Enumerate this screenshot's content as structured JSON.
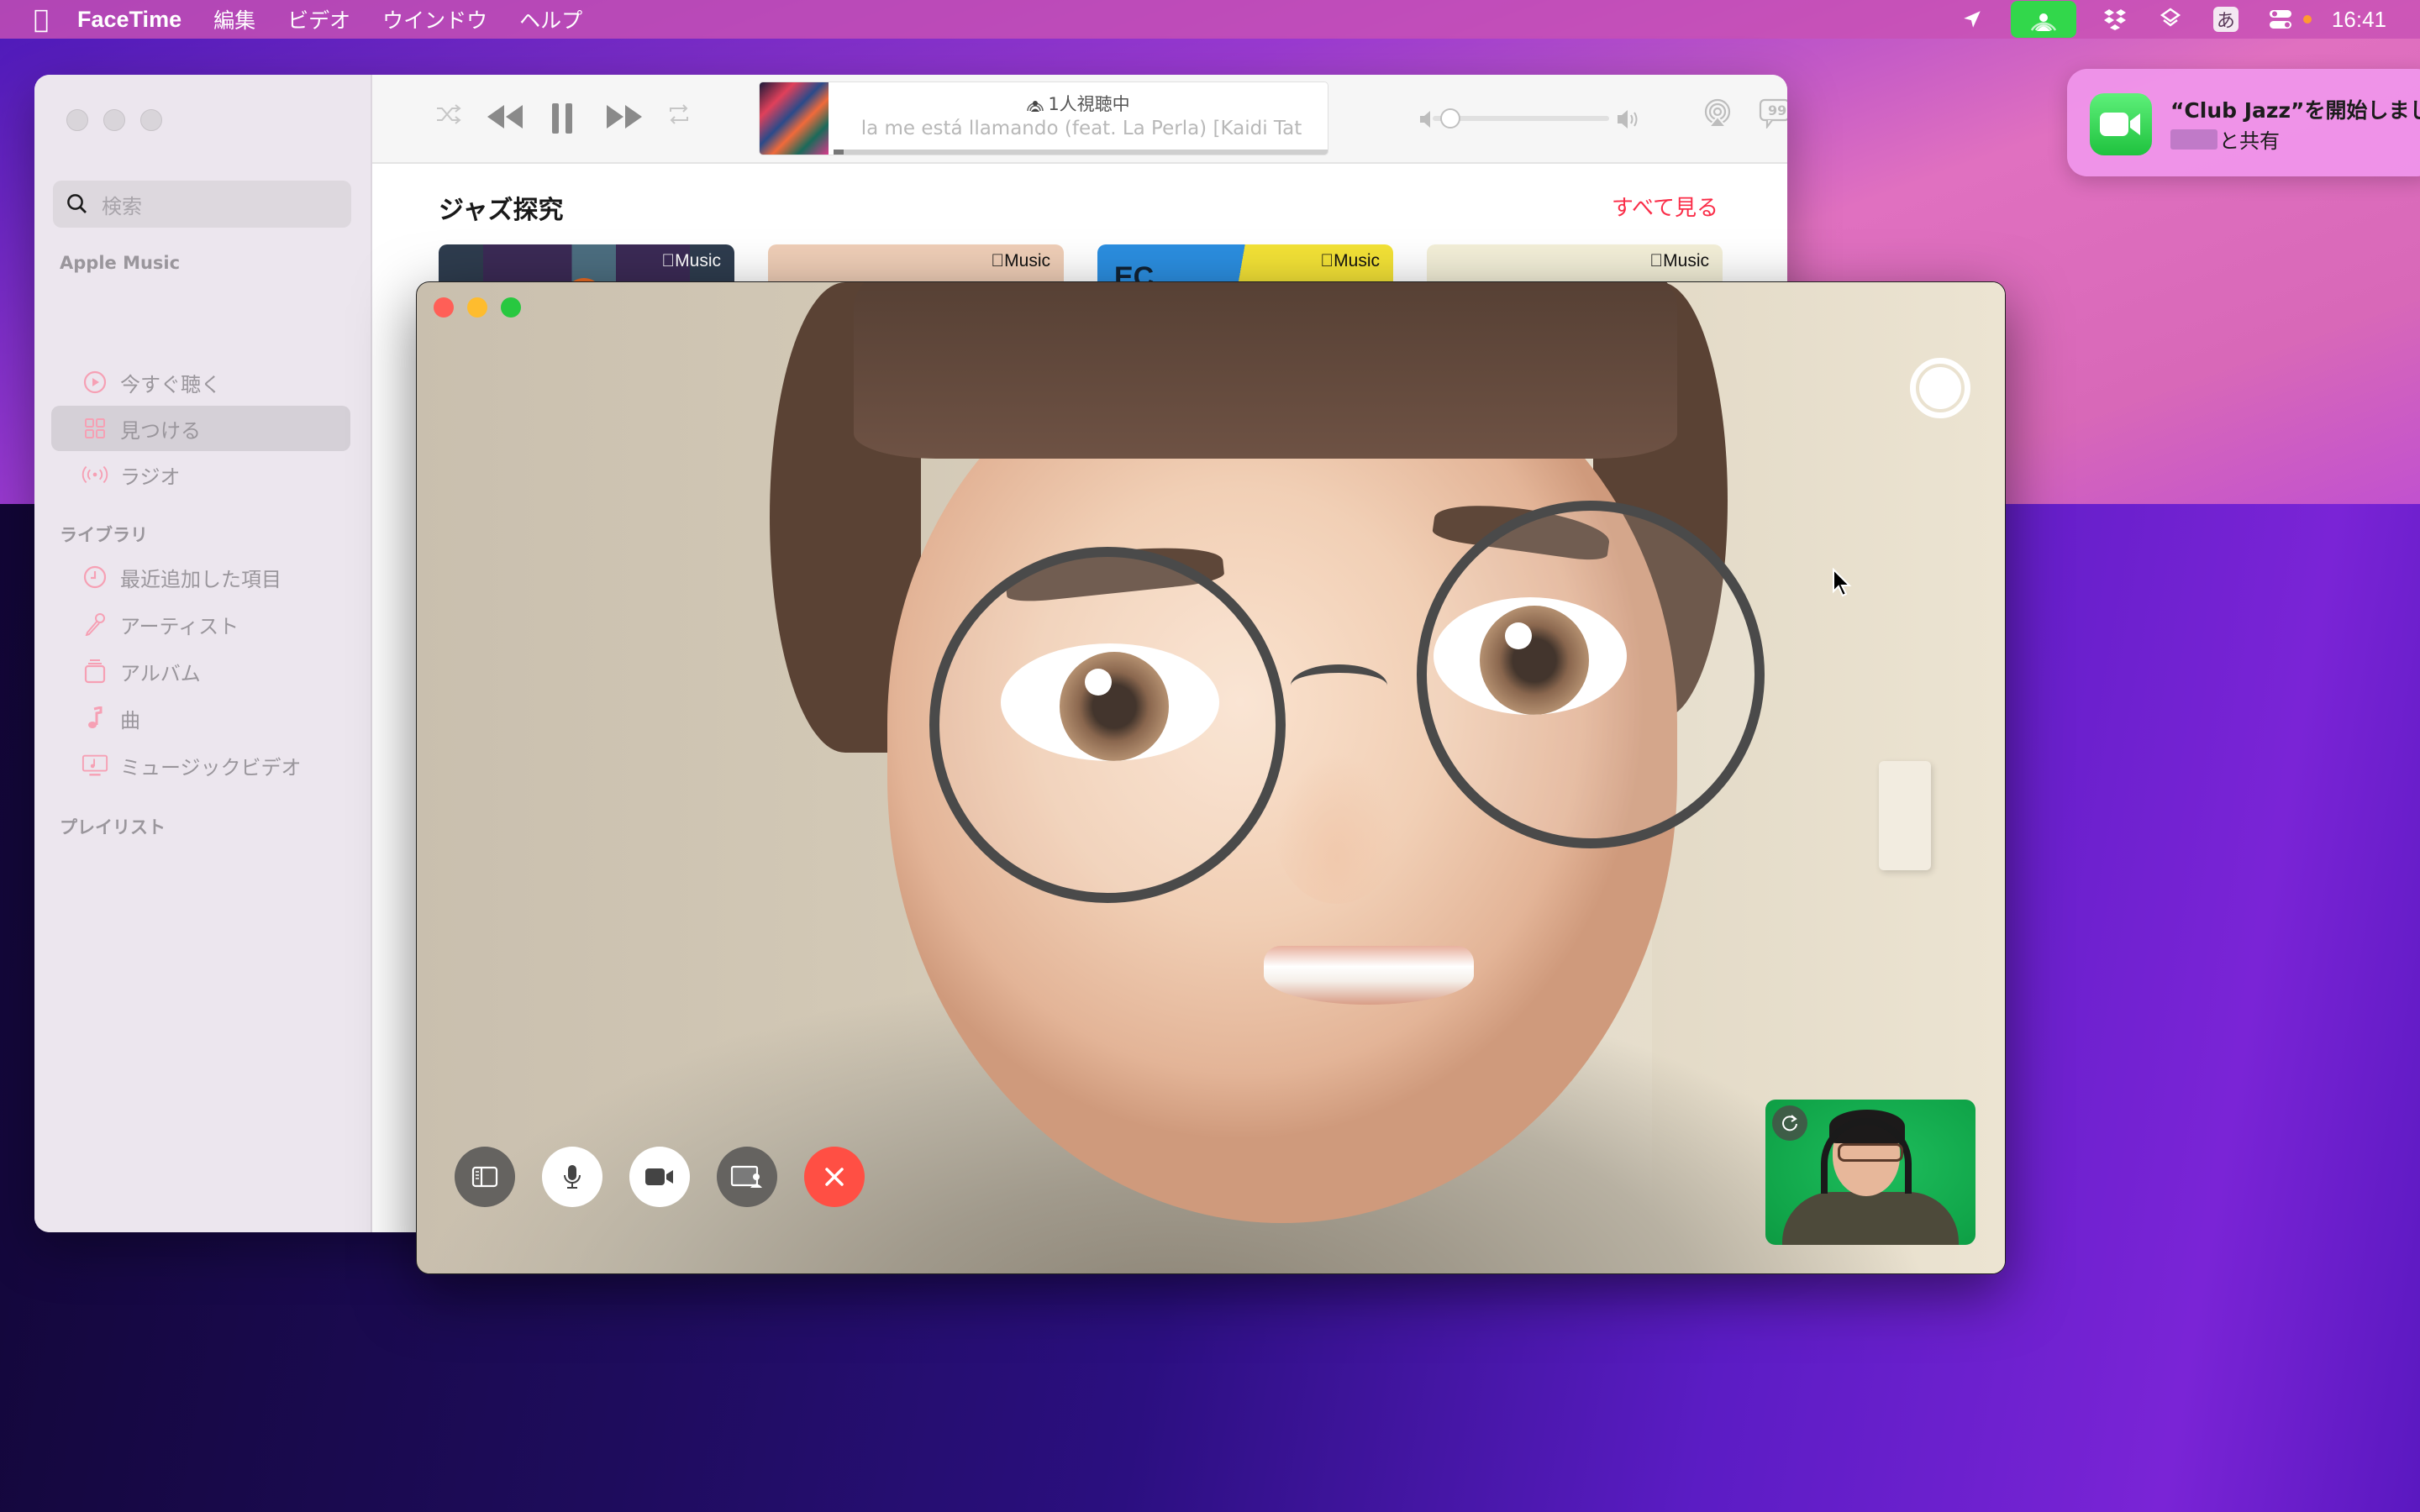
{
  "menubar": {
    "apple_icon": "apple-logo-icon",
    "app_name": "FaceTime",
    "menus": [
      "編集",
      "ビデオ",
      "ウインドウ",
      "ヘルプ"
    ],
    "status_icons": [
      "location-arrow-icon",
      "shareplay-icon",
      "dropbox-icon",
      "layers-icon",
      "input-method-icon",
      "control-center-icon"
    ],
    "input_method": "あ",
    "clock": "16:41"
  },
  "notification": {
    "app_icon": "facetime-video-icon",
    "title": "“Club Jazz”を開始しました",
    "subtitle": "と共有"
  },
  "music": {
    "search": {
      "placeholder": "検索"
    },
    "sections": {
      "apple_music": "Apple Music",
      "library": "ライブラリ",
      "playlists": "プレイリスト"
    },
    "apple_music_items": [
      {
        "label": "今すぐ聴く",
        "icon": "play-circle-icon",
        "active": false
      },
      {
        "label": "見つける",
        "icon": "grid-icon",
        "active": true
      },
      {
        "label": "ラジオ",
        "icon": "radio-waves-icon",
        "active": false
      }
    ],
    "library_items": [
      {
        "label": "最近追加した項目",
        "icon": "clock-icon"
      },
      {
        "label": "アーティスト",
        "icon": "microphone-icon"
      },
      {
        "label": "アルバム",
        "icon": "album-stack-icon"
      },
      {
        "label": "曲",
        "icon": "music-note-icon"
      },
      {
        "label": "ミュージックビデオ",
        "icon": "music-video-icon"
      }
    ],
    "player": {
      "listeners": "1人視聴中",
      "song": "la me está llamando (feat. La Perla) [Kaidi Tat",
      "progress": 0.02,
      "volume": 0.05
    },
    "content": {
      "section_title": "ジャズ探究",
      "see_all": "すべて見る",
      "card_badge": "Music",
      "cards": [
        {
          "badge": "Music",
          "color": "#3b3a5a"
        },
        {
          "badge": "Music",
          "color": "#efceb7"
        },
        {
          "badge": "Music",
          "color": "#2b8ee0"
        },
        {
          "badge": "Music",
          "color": "#f3efd8"
        }
      ]
    }
  },
  "facetime": {
    "controls": [
      {
        "name": "sidebar-toggle-button",
        "icon": "sidebar-icon"
      },
      {
        "name": "mute-button",
        "icon": "microphone-icon"
      },
      {
        "name": "camera-button",
        "icon": "video-camera-icon"
      },
      {
        "name": "share-screen-button",
        "icon": "screen-share-icon"
      },
      {
        "name": "end-call-button",
        "icon": "close-icon"
      }
    ],
    "capture_button": "live-photo-shutter-icon",
    "selfview_flip": "rotate-icon"
  },
  "colors": {
    "accent_red": "#fa2d48",
    "facetime_green": "#32d74b",
    "end_call": "#ff4f44",
    "close": "#ff5f57",
    "minimize": "#febc2e",
    "zoom": "#28c840"
  }
}
